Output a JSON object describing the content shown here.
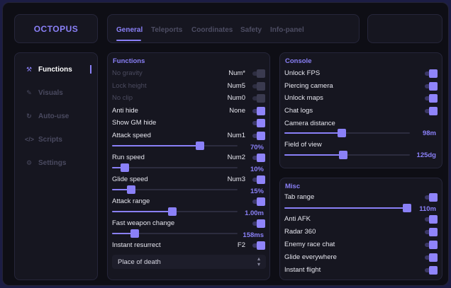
{
  "app": {
    "title": "OCTOPUS"
  },
  "tabs": [
    {
      "label": "General",
      "active": true
    },
    {
      "label": "Teleports",
      "active": false
    },
    {
      "label": "Coordinates",
      "active": false
    },
    {
      "label": "Safety",
      "active": false
    },
    {
      "label": "Info-panel",
      "active": false
    }
  ],
  "sidebar": {
    "items": [
      {
        "label": "Functions",
        "icon": "wrench-icon",
        "active": true
      },
      {
        "label": "Visuals",
        "icon": "brush-icon",
        "active": false
      },
      {
        "label": "Auto-use",
        "icon": "refresh-icon",
        "active": false
      },
      {
        "label": "Scripts",
        "icon": "code-icon",
        "active": false
      },
      {
        "label": "Settings",
        "icon": "gear-icon",
        "active": false
      }
    ]
  },
  "functions": {
    "title": "Functions",
    "no_gravity": {
      "label": "No gravity",
      "key": "Num*",
      "on": false,
      "disabled": true
    },
    "lock_height": {
      "label": "Lock height",
      "key": "Num5",
      "on": false,
      "disabled": true
    },
    "no_clip": {
      "label": "No clip",
      "key": "Num0",
      "on": false,
      "disabled": true
    },
    "anti_hide": {
      "label": "Anti hide",
      "key": "None",
      "on": true
    },
    "show_gm_hide": {
      "label": "Show GM hide",
      "on": true
    },
    "attack_speed": {
      "label": "Attack speed",
      "key": "Num1",
      "on": true,
      "value": 0.7,
      "value_text": "70%"
    },
    "run_speed": {
      "label": "Run speed",
      "key": "Num2",
      "on": true,
      "value": 0.1,
      "value_text": "10%"
    },
    "glide_speed": {
      "label": "Glide speed",
      "key": "Num3",
      "on": true,
      "value": 0.15,
      "value_text": "15%"
    },
    "attack_range": {
      "label": "Attack range",
      "on": true,
      "value": 0.48,
      "value_text": "1.00m"
    },
    "fast_weapon_change": {
      "label": "Fast weapon change",
      "on": true,
      "value": 0.18,
      "value_text": "158ms"
    },
    "instant_resurrect": {
      "label": "Instant resurrect",
      "key": "F2",
      "on": true
    },
    "resurrect_select": {
      "value": "Place of death"
    }
  },
  "console": {
    "title": "Console",
    "unlock_fps": {
      "label": "Unlock FPS",
      "on": true
    },
    "piercing_camera": {
      "label": "Piercing camera",
      "on": true
    },
    "unlock_maps": {
      "label": "Unlock maps",
      "on": true
    },
    "chat_logs": {
      "label": "Chat logs",
      "on": true
    },
    "camera_distance": {
      "label": "Camera distance",
      "value": 0.46,
      "value_text": "98m"
    },
    "field_of_view": {
      "label": "Field of view",
      "value": 0.47,
      "value_text": "125dg"
    }
  },
  "misc": {
    "title": "Misc",
    "tab_range": {
      "label": "Tab range",
      "on": true,
      "value": 0.98,
      "value_text": "110m"
    },
    "anti_afk": {
      "label": "Anti AFK",
      "on": true
    },
    "radar_360": {
      "label": "Radar 360",
      "on": true
    },
    "enemy_race_chat": {
      "label": "Enemy race chat",
      "on": true
    },
    "glide_everywhere": {
      "label": "Glide everywhere",
      "on": true
    },
    "instant_flight": {
      "label": "Instant flight",
      "on": true
    }
  },
  "colors": {
    "accent": "#8a80f7",
    "background": "#0e0e15",
    "panel": "#161620",
    "outer": "#1c1d44"
  }
}
